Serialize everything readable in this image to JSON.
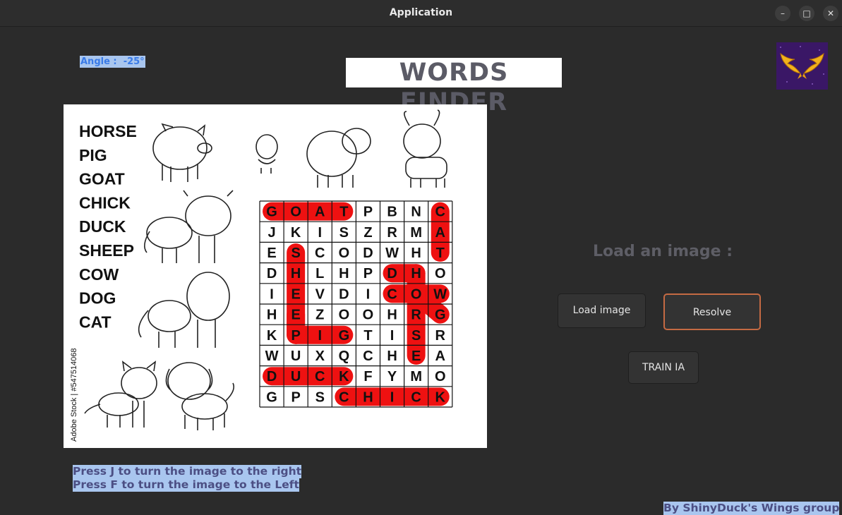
{
  "window": {
    "title": "Application",
    "minimize_glyph": "–",
    "maximize_glyph": "□",
    "close_glyph": "✕"
  },
  "angle": {
    "label": "Angle :",
    "value": "-25°"
  },
  "app_title": "WORDS FINDER",
  "puzzle": {
    "words": [
      "HORSE",
      "PIG",
      "GOAT",
      "CHICK",
      "DUCK",
      "SHEEP",
      "COW",
      "DOG",
      "CAT"
    ],
    "credit": "Adobe Stock | #547514068",
    "grid": [
      [
        "G",
        "O",
        "A",
        "T",
        "P",
        "B",
        "N",
        "C"
      ],
      [
        "J",
        "K",
        "I",
        "S",
        "Z",
        "R",
        "M",
        "A"
      ],
      [
        "E",
        "S",
        "C",
        "O",
        "D",
        "W",
        "H",
        "T"
      ],
      [
        "D",
        "H",
        "L",
        "H",
        "P",
        "D",
        "H",
        "O"
      ],
      [
        "I",
        "E",
        "V",
        "D",
        "I",
        "C",
        "O",
        "W"
      ],
      [
        "H",
        "E",
        "Z",
        "O",
        "O",
        "H",
        "R",
        "G"
      ],
      [
        "K",
        "P",
        "I",
        "G",
        "T",
        "I",
        "S",
        "R"
      ],
      [
        "W",
        "U",
        "X",
        "Q",
        "C",
        "H",
        "E",
        "A"
      ],
      [
        "D",
        "U",
        "C",
        "K",
        "F",
        "Y",
        "M",
        "O"
      ],
      [
        "G",
        "P",
        "S",
        "C",
        "H",
        "I",
        "C",
        "K"
      ]
    ],
    "highlight_color": "#ee1111"
  },
  "load_label": "Load an image :",
  "buttons": {
    "load": "Load image",
    "resolve": "Resolve",
    "train": "TRAIN IA"
  },
  "hints": [
    "Press J to turn the image to the right",
    "Press F to turn the image to the Left"
  ],
  "footer": "By ShinyDuck's Wings group",
  "colors": {
    "background": "#2b2b2b",
    "highlight_text_bg": "#a9c6ef",
    "resolve_border": "#c46a43"
  }
}
